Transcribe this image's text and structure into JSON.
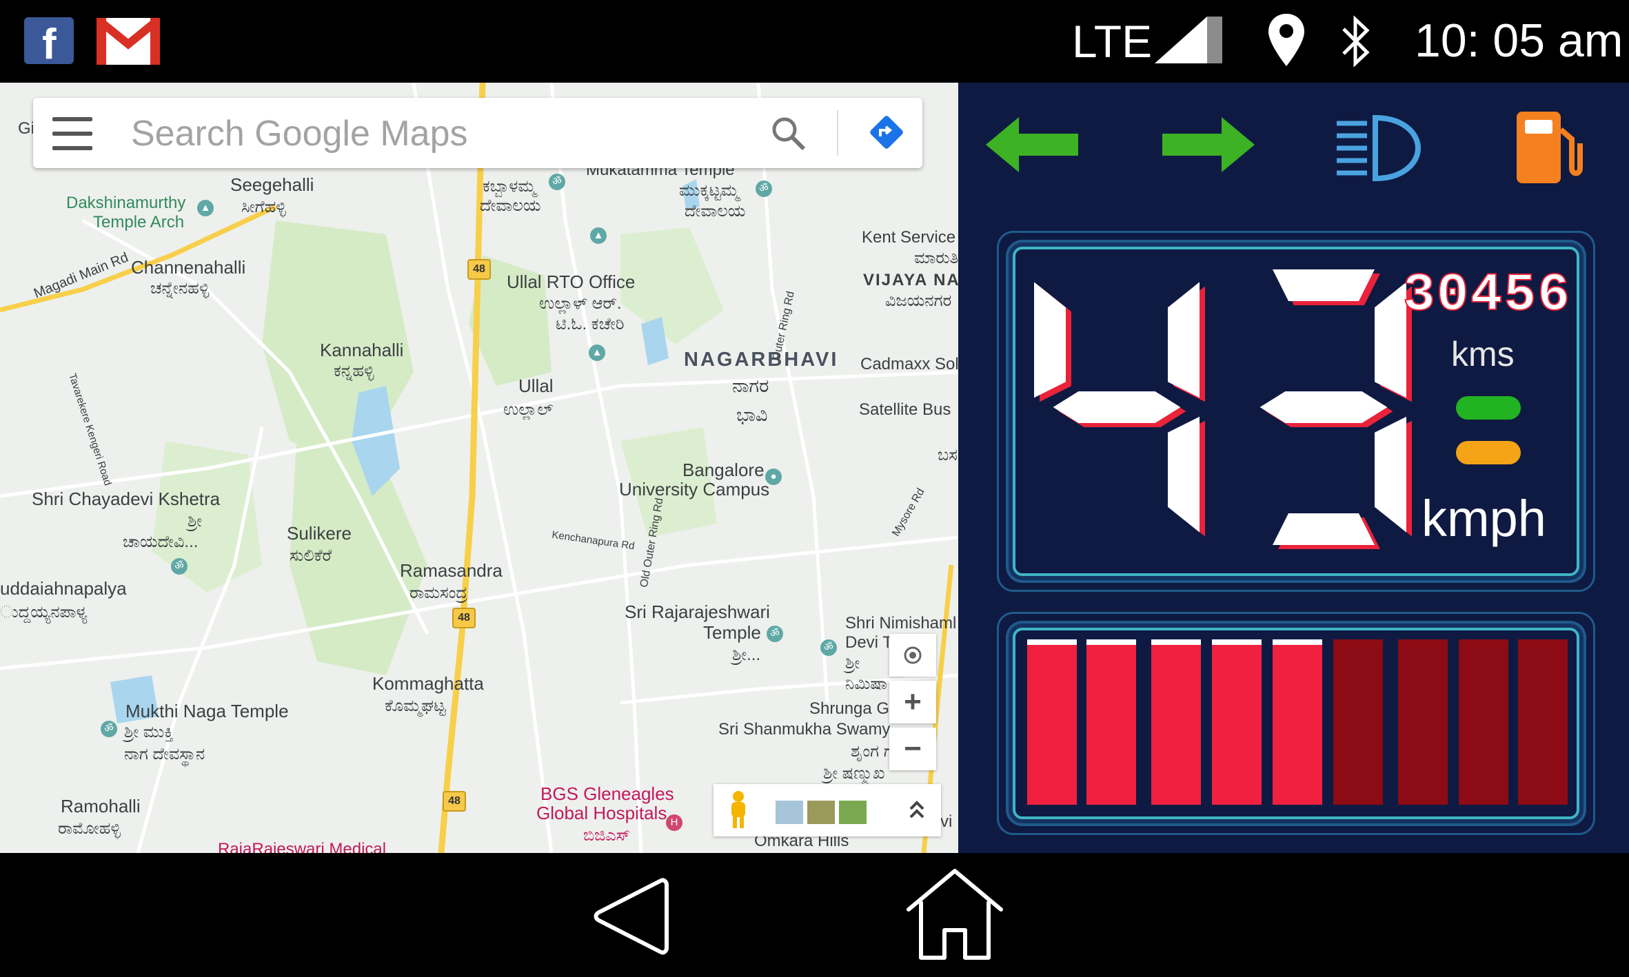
{
  "status_bar": {
    "apps": [
      "facebook-icon",
      "gmail-icon"
    ],
    "network": "LTE",
    "time": "10: 05 am"
  },
  "map": {
    "search_placeholder": "Search Google Maps",
    "labels": {
      "gi": "Gi",
      "seegehalli": "Seegehalli",
      "seegehalli_kn": "ಸೀಗೆಹಳ್ಳಿ",
      "dakshinamurthy": "Dakshinamurthy",
      "temple_arch": "Temple Arch",
      "magadi": "Magadi Main Rd",
      "channenahalli": "Channenahalli",
      "channenahalli_kn": "ಚನ್ನೇನಹಳ್ಳಿ",
      "kabbalamma_kn": "ಕಬ್ಬಾಳಮ್ಮ",
      "devalaya_kn": "ದೇವಾಲಯ",
      "mukatamma": "Mukatamma Temple",
      "mukatamma_kn": "ಮುಕ್ಕಟ್ಟಮ್ಮ",
      "mukatamma_kn2": "ದೇವಾಲಯ",
      "kent": "Kent Service",
      "kent_kn": "ಮಾರುತಿ",
      "vijaya": "VIJAYA NAG",
      "vijaya_kn": "ವಿಜಯನಗರ",
      "ullal_rto": "Ullal RTO Office",
      "ullal_rto_kn": "ಉಲ್ಲಾಳ್ ಆರ್.",
      "ullal_rto_kn2": "ಟಿ.ಓ. ಕಚೇರಿ",
      "kannahalli": "Kannahalli",
      "kannahalli_kn": "ಕನ್ನಹಳ್ಳಿ",
      "nagarbhavi": "NAGARBHAVI",
      "nagarbhavi_kn": "ನಾಗರ",
      "nagarbhavi_kn2": "ಭಾವಿ",
      "cadmaxx": "Cadmaxx Sol",
      "ullal": "Ullal",
      "ullal_kn": "ಉಲ್ಲಾಲ್",
      "satellite": "Satellite Bus",
      "outer_ring": "Outer Ring Rd",
      "tavarekere": "Tavarekere Kengeri Road",
      "bangalore_univ": "Bangalore",
      "bangalore_univ2": "University Campus",
      "shri_chayadevi": "Shri Chayadevi Kshetra",
      "shri_kn": "ಶ್ರೀ",
      "chayadevi_kn": "ಚಾಯದೇವಿ...",
      "sulikere": "Sulikere",
      "sulikere_kn": "ಸುಲಿಕೆರೆ",
      "kenchanapura": "Kenchanapura Rd",
      "old_outer": "Old Outer Ring Rd",
      "mysore_rd": "Mysore Rd",
      "uddaiahnapalya": "uddaiahnapalya",
      "uddaiahnapalya_kn": "ುದ್ದಯ್ಯನಪಾಳ್ಯ",
      "ramasandra": "Ramasandra",
      "ramasandra_kn": "ರಾಮಸಂದ್ರ",
      "rajarajeshwari": "Sri Rajarajeshwari",
      "rajarajeshwari2": "Temple",
      "rajarajeshwari_kn": "ಶ್ರೀ...",
      "nimishamba": "Shri Nimishaml",
      "nimishamba2": "Devi T",
      "nimishamba_kn": "ಶ್ರೀ",
      "nimishamba_kn2": "ನಿಮಿಷಾ",
      "kommaghatta": "Kommaghatta",
      "kommaghatta_kn": "ಕೊಮ್ಮಘಟ್ಟ",
      "shrunga": "Shrunga G",
      "shanmukha": "Sri Shanmukha Swamy",
      "shanmukha_kn": "ಶೃಂಗ ಗ",
      "shanmukha_kn2": "ಶ್ರೀ ಷಣ್ಮುಖ",
      "mukthi": "Mukthi Naga Temple",
      "mukthi_kn": "ಶ್ರೀ ಮುಕ್ತಿ",
      "mukthi_kn2": "ನಾಗ ದೇವಸ್ಥಾನ",
      "ramohalli": "Ramohalli",
      "ramohalli_kn": "ರಾಮೋಹಳ್ಳಿ",
      "bgs": "BGS Gleneagles",
      "bgs2": "Global Hospitals",
      "bgs_kn": "ಬಿಜಿಎಸ್",
      "omkara": "Omkara Hills",
      "rajarajeswari_med": "RajaRajeswari Medical",
      "vi": "vi",
      "basa": "ಬಸ",
      "nh48": "48"
    },
    "controls": {
      "zoom_in": "+",
      "zoom_out": "−"
    }
  },
  "dashboard": {
    "speed": 43,
    "odometer": "30456",
    "odometer_unit": "kms",
    "speed_unit": "kmph",
    "level_bars": {
      "total": 9,
      "lit": 5
    },
    "colors": {
      "background": "#0e1a42",
      "arrow_green": "#3cb224",
      "headlight_blue": "#4aa3e0",
      "fuel_orange": "#f4801f",
      "segment_red": "#e8233a",
      "bar_lit": "#f1203f",
      "bar_dim": "#8c0b14",
      "pill_green": "#22b322",
      "pill_orange": "#f5a416"
    }
  },
  "navigation": {
    "buttons": [
      "back-button",
      "home-button"
    ]
  }
}
